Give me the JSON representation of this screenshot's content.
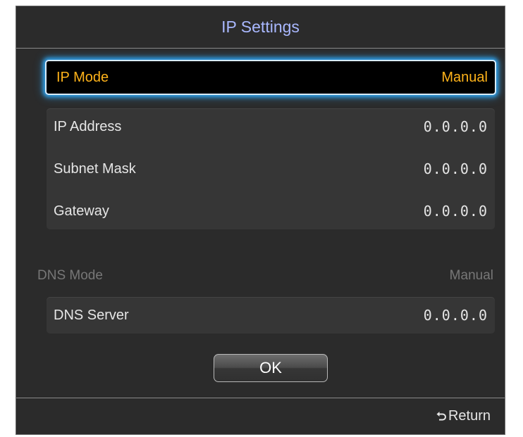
{
  "dialog": {
    "title": "IP Settings"
  },
  "ip_mode": {
    "label": "IP Mode",
    "value": "Manual"
  },
  "ip_fields": [
    {
      "label": "IP Address",
      "value": "0.0.0.0"
    },
    {
      "label": "Subnet Mask",
      "value": "0.0.0.0"
    },
    {
      "label": "Gateway",
      "value": "0.0.0.0"
    }
  ],
  "dns_mode": {
    "label": "DNS Mode",
    "value": "Manual"
  },
  "dns_server": {
    "label": "DNS Server",
    "value": "0.0.0.0"
  },
  "ok_button": {
    "label": "OK"
  },
  "footer": {
    "return_label": "Return",
    "return_icon": "return-arrow-icon"
  },
  "colors": {
    "dialog_bg": "#2b2b2b",
    "title": "#a9b8ff",
    "focus_text": "#ffb31a",
    "focus_glow": "#2e9ee6",
    "dim_text": "#777777"
  }
}
